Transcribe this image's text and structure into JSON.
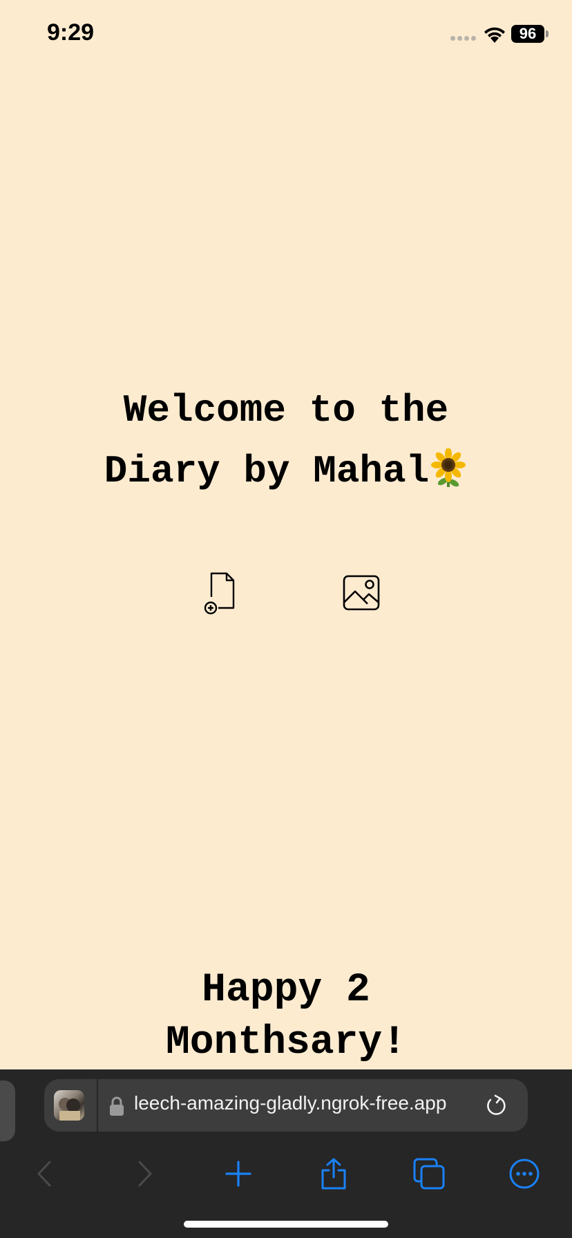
{
  "status_bar": {
    "time": "9:29",
    "battery": "96"
  },
  "page": {
    "background_color": "#FDEBD0",
    "welcome_line1": "Welcome to the",
    "welcome_line2": "Diary by Mahal",
    "welcome_emoji_icon": "sunflower-icon",
    "actions": [
      {
        "icon": "new-document-icon"
      },
      {
        "icon": "image-gallery-icon"
      }
    ],
    "footer_line1": "Happy 2",
    "footer_line2": "Monthsary!"
  },
  "browser": {
    "url": "leech-amazing-gladly.ngrok-free.app",
    "accent_color": "#1A82F7",
    "toolbar": [
      {
        "icon": "back-icon",
        "enabled": false
      },
      {
        "icon": "forward-icon",
        "enabled": false
      },
      {
        "icon": "new-tab-plus-icon",
        "enabled": true
      },
      {
        "icon": "share-icon",
        "enabled": true
      },
      {
        "icon": "tabs-icon",
        "enabled": true
      },
      {
        "icon": "more-icon",
        "enabled": true
      }
    ]
  }
}
